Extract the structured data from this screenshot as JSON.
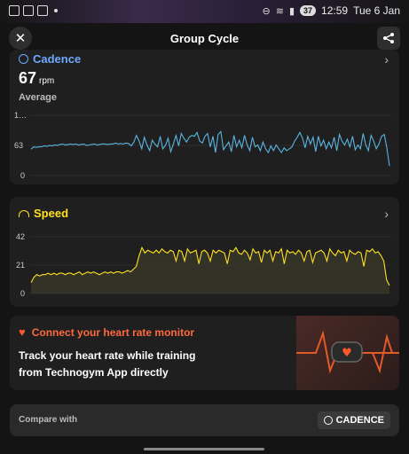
{
  "status_bar": {
    "time": "12:59",
    "date": "Tue 6 Jan",
    "battery": "37"
  },
  "header": {
    "title": "Group Cycle"
  },
  "cadence": {
    "title": "Cadence",
    "value": "67",
    "unit": "rpm",
    "caption": "Average",
    "chart": {
      "y_ticks": [
        "1…",
        "63",
        "0"
      ],
      "ylim": [
        0,
        126
      ],
      "color": "#5ab4e0",
      "values": [
        55,
        60,
        59,
        60,
        60,
        62,
        61,
        63,
        62,
        64,
        63,
        65,
        66,
        64,
        65,
        66,
        65,
        66,
        64,
        65,
        66,
        63,
        64,
        65,
        66,
        64,
        65,
        66,
        66,
        65,
        66,
        66,
        68,
        66,
        67,
        66,
        68,
        67,
        62,
        70,
        84,
        72,
        56,
        80,
        64,
        52,
        74,
        66,
        60,
        82,
        56,
        63,
        78,
        50,
        66,
        84,
        62,
        88,
        78,
        70,
        80,
        84,
        82,
        90,
        72,
        68,
        82,
        88,
        60,
        82,
        48,
        86,
        92,
        54,
        62,
        70,
        50,
        84,
        60,
        74,
        58,
        84,
        64,
        52,
        80,
        60,
        64,
        52,
        70,
        56,
        48,
        62,
        52,
        64,
        56,
        48,
        58,
        52,
        56,
        60,
        72,
        80,
        90,
        78,
        58,
        82,
        66,
        80,
        50,
        82,
        62,
        74,
        56,
        70,
        58,
        80,
        52,
        86,
        72,
        64,
        76,
        60,
        82,
        54,
        64,
        56,
        88,
        64,
        52,
        84,
        72,
        56,
        66,
        82,
        86,
        58,
        20
      ]
    }
  },
  "speed": {
    "title": "Speed",
    "chart": {
      "y_ticks": [
        "42",
        "21",
        "0"
      ],
      "ylim": [
        0,
        42
      ],
      "color": "#ffe020",
      "values": [
        8,
        12,
        14,
        13,
        14,
        14,
        15,
        14,
        15,
        14,
        15,
        15,
        14,
        15,
        15,
        14,
        15,
        16,
        14,
        15,
        16,
        15,
        16,
        15,
        14,
        15,
        16,
        15,
        16,
        15,
        16,
        16,
        15,
        16,
        17,
        16,
        18,
        20,
        28,
        34,
        30,
        32,
        31,
        30,
        32,
        30,
        33,
        31,
        30,
        32,
        31,
        24,
        32,
        31,
        24,
        33,
        30,
        31,
        32,
        22,
        31,
        32,
        30,
        24,
        32,
        30,
        32,
        31,
        30,
        22,
        32,
        31,
        34,
        30,
        29,
        32,
        30,
        25,
        33,
        30,
        31,
        23,
        32,
        30,
        32,
        24,
        31,
        30,
        33,
        22,
        32,
        30,
        31,
        29,
        32,
        30,
        24,
        31,
        32,
        23,
        30,
        31,
        32,
        30,
        24,
        33,
        30,
        28,
        32,
        30,
        31,
        24,
        32,
        30,
        29,
        31,
        30,
        20,
        32,
        31,
        33,
        30,
        31,
        28,
        24,
        10,
        6
      ]
    }
  },
  "hr_card": {
    "title": "Connect your heart rate monitor",
    "line1": "Track your heart rate while training",
    "line2": "from Technogym App directly"
  },
  "compare": {
    "label": "Compare with",
    "chip": "CADENCE"
  },
  "colors": {
    "cadence": "#5ab4e0",
    "speed": "#ffe020",
    "heart": "#ff5a2a",
    "background": "#141414"
  }
}
